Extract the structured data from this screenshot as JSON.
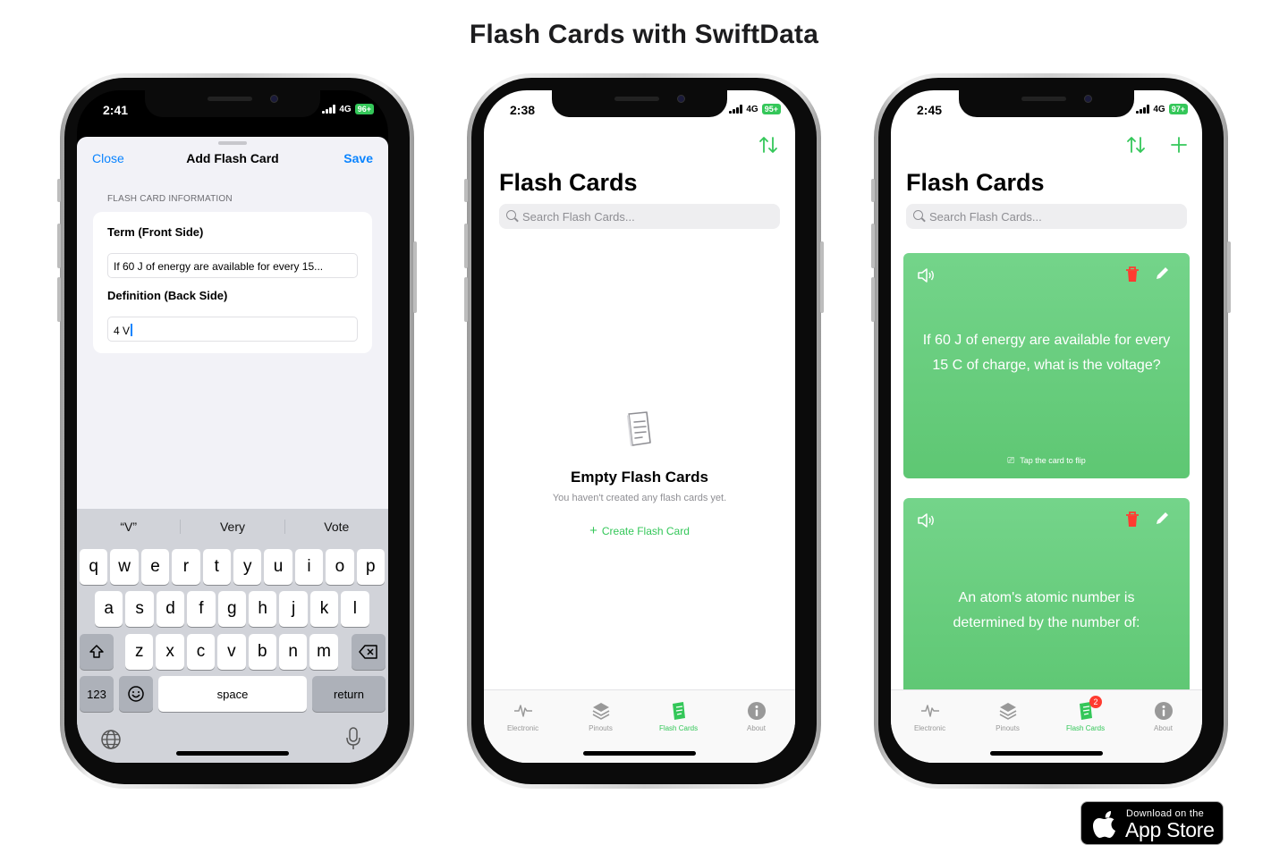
{
  "page": {
    "title": "Flash Cards with SwiftData"
  },
  "phone1": {
    "time": "2:41",
    "network": "4G",
    "battery": "96+",
    "nav": {
      "close": "Close",
      "title": "Add Flash Card",
      "save": "Save"
    },
    "section_header": "FLASH CARD INFORMATION",
    "term_label": "Term (Front Side)",
    "term_value": "If 60 J of energy are available for every 15...",
    "definition_label": "Definition (Back Side)",
    "definition_value": "4 V",
    "suggestions": [
      "“V”",
      "Very",
      "Vote"
    ],
    "keys_row1": [
      "q",
      "w",
      "e",
      "r",
      "t",
      "y",
      "u",
      "i",
      "o",
      "p"
    ],
    "keys_row2": [
      "a",
      "s",
      "d",
      "f",
      "g",
      "h",
      "j",
      "k",
      "l"
    ],
    "keys_row3": [
      "z",
      "x",
      "c",
      "v",
      "b",
      "n",
      "m"
    ],
    "key_123": "123",
    "key_space": "space",
    "key_return": "return"
  },
  "phone2": {
    "time": "2:38",
    "network": "4G",
    "battery": "95+",
    "title": "Flash Cards",
    "search_placeholder": "Search Flash Cards...",
    "empty_title": "Empty Flash Cards",
    "empty_subtitle": "You haven't created any flash cards yet.",
    "create_button": "Create Flash Card",
    "tabs": [
      "Electronic",
      "Pinouts",
      "Flash Cards",
      "About"
    ]
  },
  "phone3": {
    "time": "2:45",
    "network": "4G",
    "battery": "97+",
    "title": "Flash Cards",
    "search_placeholder": "Search Flash Cards...",
    "cards": [
      {
        "question": "If 60 J of energy are available for every 15 C of charge, what is the voltage?",
        "hint": "Tap the card to flip"
      },
      {
        "question": "An atom's atomic number is determined by the number of:"
      }
    ],
    "tabs": [
      "Electronic",
      "Pinouts",
      "Flash Cards",
      "About"
    ],
    "badge": "2"
  },
  "appstore": {
    "line1": "Download on the",
    "line2": "App Store"
  },
  "colors": {
    "accent_green": "#34c759",
    "ios_blue": "#0a84ff",
    "delete_red": "#ff3b30"
  }
}
